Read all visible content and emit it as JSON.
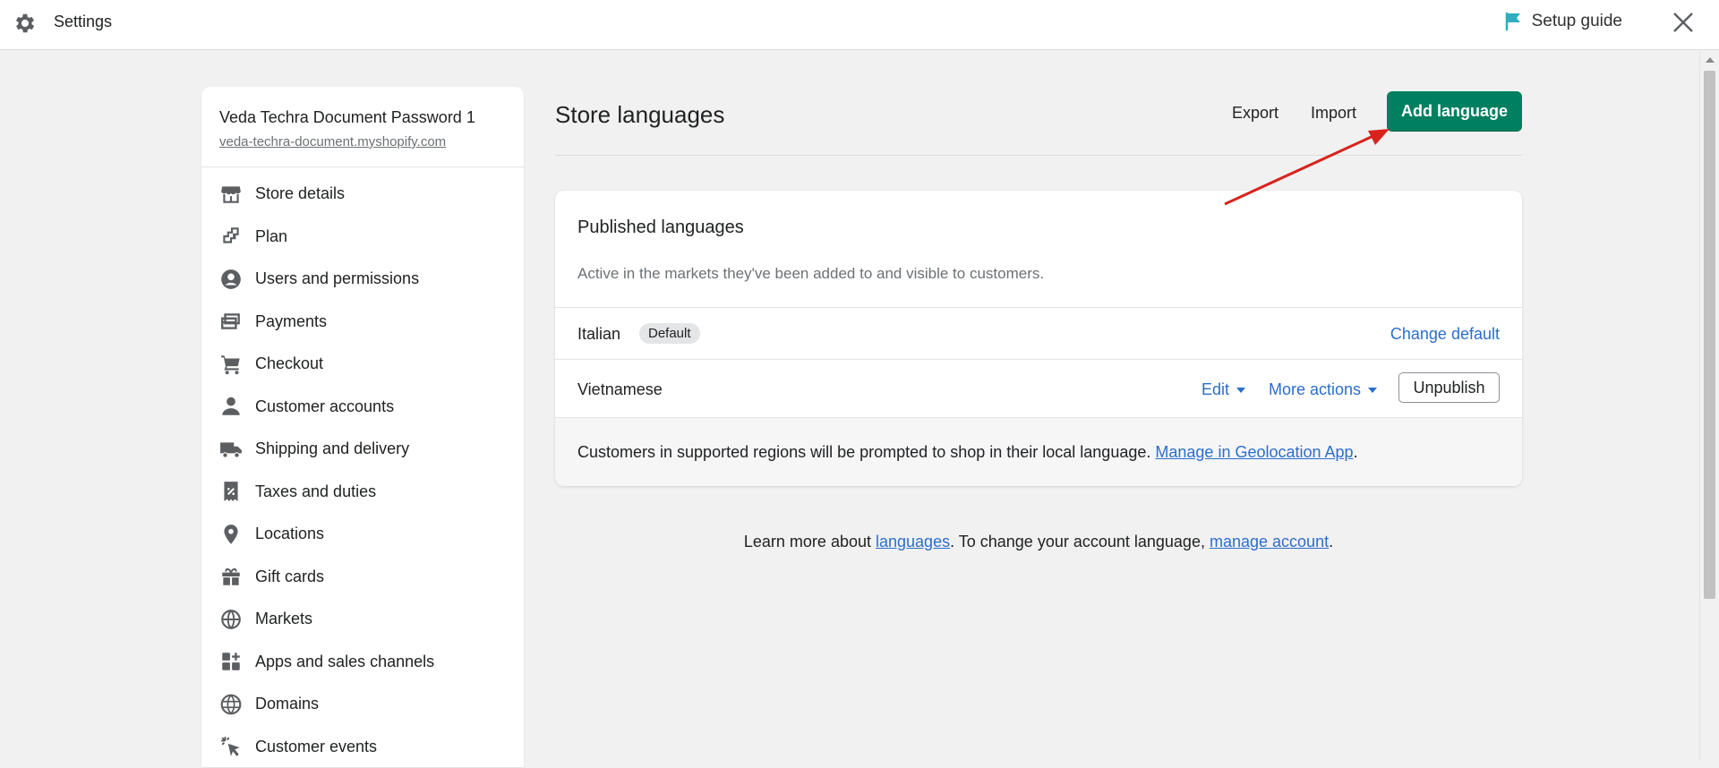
{
  "topbar": {
    "title": "Settings",
    "setup_guide": "Setup guide",
    "icons": {
      "settings": "gear-icon",
      "flag": "flag-icon",
      "close": "close-icon"
    },
    "flag_color": "#2eaec1"
  },
  "store": {
    "name": "Veda Techra Document Password 1",
    "url": "veda-techra-document.myshopify.com"
  },
  "sidebar": {
    "items": [
      {
        "label": "Store details",
        "icon": "store-icon"
      },
      {
        "label": "Plan",
        "icon": "plan-icon"
      },
      {
        "label": "Users and permissions",
        "icon": "user-circle-icon"
      },
      {
        "label": "Payments",
        "icon": "payments-icon"
      },
      {
        "label": "Checkout",
        "icon": "cart-icon"
      },
      {
        "label": "Customer accounts",
        "icon": "person-icon"
      },
      {
        "label": "Shipping and delivery",
        "icon": "truck-icon"
      },
      {
        "label": "Taxes and duties",
        "icon": "receipt-icon"
      },
      {
        "label": "Locations",
        "icon": "location-pin-icon"
      },
      {
        "label": "Gift cards",
        "icon": "gift-icon"
      },
      {
        "label": "Markets",
        "icon": "globe-icon"
      },
      {
        "label": "Apps and sales channels",
        "icon": "apps-icon"
      },
      {
        "label": "Domains",
        "icon": "globe-grid-icon"
      },
      {
        "label": "Customer events",
        "icon": "cursor-click-icon"
      }
    ]
  },
  "main": {
    "title": "Store languages",
    "export_label": "Export",
    "import_label": "Import",
    "add_language_label": "Add language",
    "accent_color": "#008060",
    "published": {
      "title": "Published languages",
      "description": "Active in the markets they've been added to and visible to customers.",
      "languages": [
        {
          "name": "Italian",
          "badge": "Default",
          "action": "Change default"
        },
        {
          "name": "Vietnamese",
          "edit": "Edit",
          "more_actions": "More actions",
          "unpublish": "Unpublish"
        }
      ],
      "footer_text": "Customers in supported regions will be prompted to shop in their local language.",
      "footer_link": "Manage in Geolocation App",
      "footer_end": "."
    },
    "learn_more": {
      "prefix": "Learn more about",
      "languages_link": "languages",
      "middle": ". To change your account language,",
      "account_link": "manage account",
      "end": "."
    }
  },
  "annotation": {
    "arrow_color": "#d9221c"
  }
}
